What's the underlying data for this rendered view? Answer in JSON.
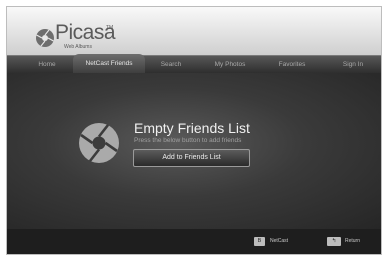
{
  "header": {
    "logo": {
      "name": "Picasa",
      "tm": "TM",
      "subtitle": "Web Albums",
      "icon": "picasa-logo-icon"
    }
  },
  "nav": {
    "tabs": [
      {
        "label": "Home"
      },
      {
        "label": "NetCast Friends",
        "active": true
      },
      {
        "label": "Search"
      },
      {
        "label": "My Photos"
      },
      {
        "label": "Favorites"
      },
      {
        "label": "Sign In"
      }
    ]
  },
  "main": {
    "icon": "picasa-aperture-icon",
    "title": "Empty Friends List",
    "subtitle": "Press the below button to add friends",
    "button_label": "Add to Friends List"
  },
  "footer": {
    "netcast": {
      "key": "B",
      "label": "NetCast"
    },
    "return": {
      "key": "↰",
      "label": "Return"
    }
  },
  "colors": {
    "background": "#232323",
    "header": "#e9e9e9",
    "text": "#f0f0f0"
  }
}
